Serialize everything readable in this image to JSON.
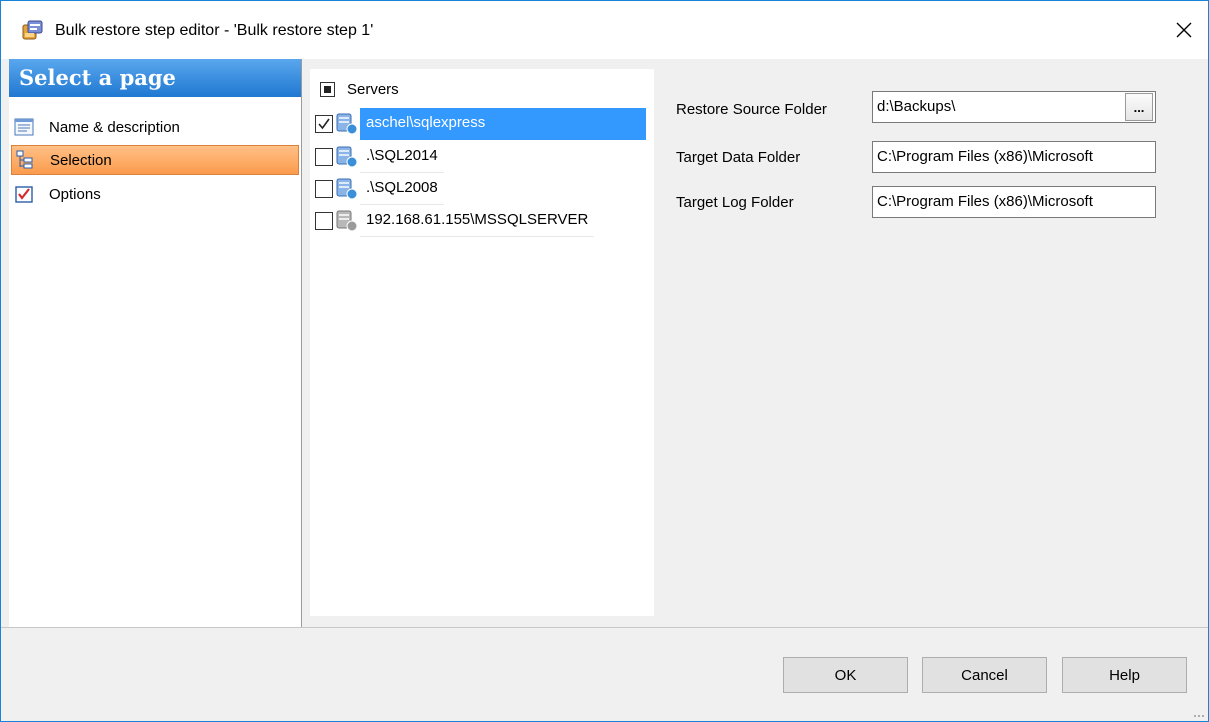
{
  "window": {
    "title": "Bulk restore step editor - 'Bulk restore step 1'",
    "accent_color": "#1883d7"
  },
  "sidebar": {
    "header": "Select a page",
    "items": [
      {
        "label": "Name & description",
        "icon": "list-page-icon",
        "selected": false
      },
      {
        "label": "Selection",
        "icon": "tree-page-icon",
        "selected": true
      },
      {
        "label": "Options",
        "icon": "options-checklist-icon",
        "selected": false
      }
    ],
    "selected_color": "#fb9b4d"
  },
  "tree": {
    "root_label": "Servers",
    "root_state": "indeterminate",
    "rows": [
      {
        "label": "aschel\\sqlexpress",
        "checked": true,
        "selected": true,
        "icon": "server-online-icon"
      },
      {
        "label": ".\\SQL2014",
        "checked": false,
        "selected": false,
        "icon": "server-online-icon"
      },
      {
        "label": ".\\SQL2008",
        "checked": false,
        "selected": false,
        "icon": "server-online-icon"
      },
      {
        "label": "192.168.61.155\\MSSQLSERVER",
        "checked": false,
        "selected": false,
        "icon": "server-offline-icon"
      }
    ]
  },
  "fields": {
    "restore_source": {
      "label": "Restore Source Folder",
      "value": "d:\\Backups\\",
      "browse_label": "..."
    },
    "target_data": {
      "label": "Target Data Folder",
      "value": "C:\\Program Files (x86)\\Microsoft"
    },
    "target_log": {
      "label": "Target Log Folder",
      "value": "C:\\Program Files (x86)\\Microsoft"
    }
  },
  "buttons": {
    "ok": "OK",
    "cancel": "Cancel",
    "help": "Help"
  }
}
